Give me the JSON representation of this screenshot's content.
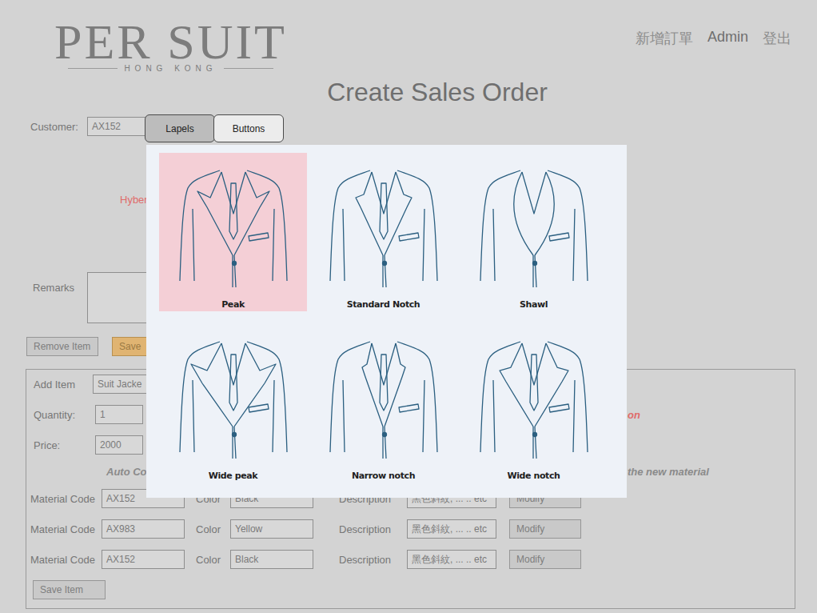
{
  "header": {
    "logo": {
      "name": "PER SUIT",
      "subtitle": "HONG KONG"
    },
    "nav": [
      "新增訂單",
      "Admin",
      "登出"
    ]
  },
  "title": "Create Sales Order",
  "customer": {
    "label": "Customer:",
    "value": "AX152"
  },
  "notice": "Hyber",
  "remarks": {
    "label": "Remarks",
    "value": ""
  },
  "actions": [
    {
      "label": "Remove Item",
      "kind": "plain"
    },
    {
      "label": "Save",
      "kind": "primary"
    }
  ],
  "item": {
    "fields": [
      {
        "label": "Add Item",
        "value": "Suit Jacke"
      },
      {
        "label": "Quantity:",
        "value": "1"
      },
      {
        "label": "Price:",
        "value": "2000"
      }
    ],
    "option_note": "on",
    "auto_note": "Auto Co",
    "auto_note_end": "the new material",
    "materials": [
      {
        "code_label": "Material Code",
        "code": "AX152",
        "color_label": "Color",
        "color": "Black",
        "description_label": "Description",
        "description": "黑色斜紋, ... .. etc",
        "button": "Modify"
      },
      {
        "code_label": "Material Code",
        "code": "AX983",
        "color_label": "Color",
        "color": "Yellow",
        "description_label": "Description",
        "description": "黑色斜紋, ... .. etc",
        "button": "Modify"
      },
      {
        "code_label": "Material Code",
        "code": "AX152",
        "color_label": "Color",
        "color": "Black",
        "description_label": "Description",
        "description": "黑色斜紋, ... .. etc",
        "button": "Modify"
      }
    ],
    "save": "Save Item"
  },
  "picker": {
    "tabs": [
      {
        "label": "Lapels",
        "selected": true
      },
      {
        "label": "Buttons",
        "selected": false
      }
    ],
    "options": [
      {
        "label": "Peak",
        "kind": "peak",
        "selected": true
      },
      {
        "label": "Standard Notch",
        "kind": "notch",
        "selected": false
      },
      {
        "label": "Shawl",
        "kind": "shawl",
        "selected": false
      },
      {
        "label": "Wide peak",
        "kind": "wide-peak",
        "selected": false
      },
      {
        "label": "Narrow notch",
        "kind": "narrow-notch",
        "selected": false
      },
      {
        "label": "Wide notch",
        "kind": "wide-notch",
        "selected": false
      }
    ]
  }
}
